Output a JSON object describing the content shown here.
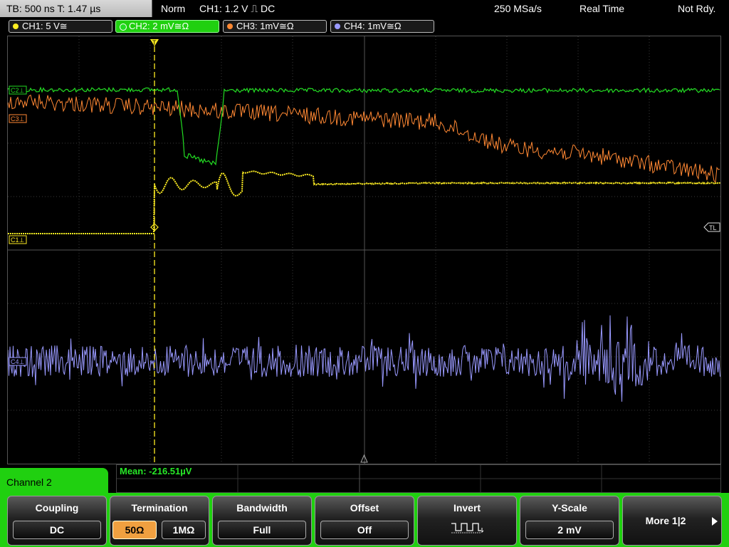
{
  "topbar": {
    "timebase": "TB: 500 ns   T: 1.47 µs",
    "mode": "Norm",
    "trigger": "CH1: 1.2 V ⎍ DC",
    "sample_rate": "250 MSa/s",
    "acq_mode": "Real Time",
    "status": "Not Rdy."
  },
  "channels": [
    {
      "label": "CH1: 5 V≅",
      "color": "#ffee22"
    },
    {
      "label": "CH2: 2 mV≅Ω",
      "color": "#22dd22"
    },
    {
      "label": "CH3: 1mV≅Ω",
      "color": "#ff8833"
    },
    {
      "label": "CH4: 1mV≅Ω",
      "color": "#9999ff"
    }
  ],
  "markers": {
    "c1": "C1⊥",
    "c2": "C2⊥",
    "c3": "C3⊥",
    "c4": "C4⊥",
    "trigger_level": "TL",
    "trigger_pos": "T"
  },
  "measurement": {
    "text": "Mean: -216.51µV"
  },
  "menu": {
    "title": "Channel 2",
    "coupling": {
      "title": "Coupling",
      "value": "DC"
    },
    "termination": {
      "title": "Termination",
      "opt1": "50Ω",
      "opt2": "1MΩ"
    },
    "bandwidth": {
      "title": "Bandwidth",
      "value": "Full"
    },
    "offset": {
      "title": "Offset",
      "value": "Off"
    },
    "invert": {
      "title": "Invert",
      "icon": "inverted-square-wave-icon"
    },
    "yscale": {
      "title": "Y-Scale",
      "value": "2 mV"
    },
    "more": {
      "label": "More 1|2"
    }
  },
  "grid_color": "#3a3a3a"
}
